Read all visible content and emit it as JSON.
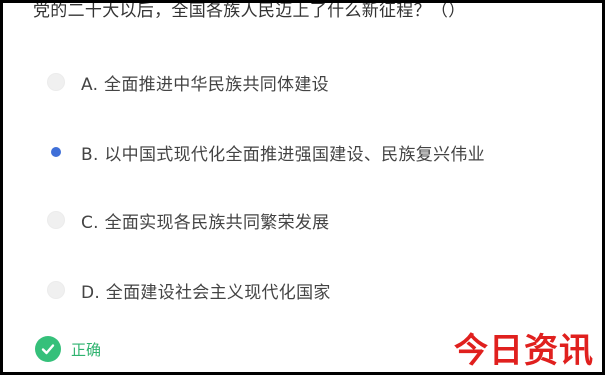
{
  "question": {
    "text": "党的二十大以后，全国各族人民迈上了什么新征程？（）"
  },
  "options": [
    {
      "label": "A. 全面推进中华民族共同体建设",
      "selected": false
    },
    {
      "label": "B. 以中国式现代化全面推进强国建设、民族复兴伟业",
      "selected": true
    },
    {
      "label": "C. 全面实现各民族共同繁荣发展",
      "selected": false
    },
    {
      "label": "D. 全面建设社会主义现代化国家",
      "selected": false
    }
  ],
  "result": {
    "text": "正确",
    "icon": "check-circle-icon",
    "color": "#35c07a"
  },
  "watermark": {
    "text": "今日资讯",
    "color": "#e0201e"
  },
  "colors": {
    "selected_radio": "#3f6fd8",
    "frame_border": "#000000"
  }
}
